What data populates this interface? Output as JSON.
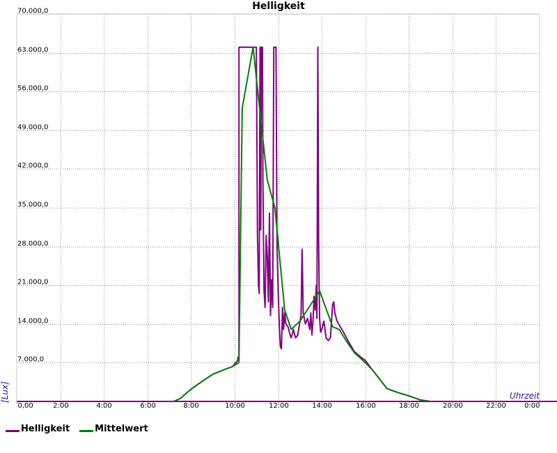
{
  "chart_data": {
    "type": "line",
    "title": "Helligkeit",
    "xlabel": "Uhrzeit",
    "ylabel": "[Lux]",
    "xlim": [
      0,
      24
    ],
    "ylim": [
      0,
      70000
    ],
    "x_ticks": [
      0,
      2,
      4,
      6,
      8,
      10,
      12,
      14,
      16,
      18,
      20,
      22,
      24
    ],
    "x_tick_labels": [
      "0,00",
      "2:00",
      "4:00",
      "6:00",
      "8:00",
      "10:00",
      "12:00",
      "14:00",
      "16:00",
      "18:00",
      "20:00",
      "22:00",
      "0:00"
    ],
    "y_ticks": [
      7000,
      14000,
      21000,
      28000,
      35000,
      42000,
      49000,
      56000,
      63000,
      70000
    ],
    "y_tick_labels": [
      "7.000,0",
      "14.000,0",
      "21.000,0",
      "28.000,0",
      "35.000,0",
      "42.000,0",
      "49.000,0",
      "56.000,0",
      "63.000,0",
      "70.000,0"
    ],
    "grid": true,
    "legend_position": "bottom-left",
    "series": [
      {
        "name": "Helligkeit",
        "color": "#800080",
        "points": [
          [
            0,
            0
          ],
          [
            7.2,
            0
          ],
          [
            7.5,
            500
          ],
          [
            8.0,
            2200
          ],
          [
            8.5,
            3600
          ],
          [
            9.0,
            4900
          ],
          [
            9.5,
            5700
          ],
          [
            9.9,
            6300
          ],
          [
            10.15,
            7400
          ],
          [
            10.15,
            7900
          ],
          [
            10.2,
            8200
          ],
          [
            10.2,
            64000
          ],
          [
            10.3,
            64000
          ],
          [
            10.6,
            64000
          ],
          [
            10.9,
            64000
          ],
          [
            11.0,
            64000
          ],
          [
            11.05,
            30000
          ],
          [
            11.1,
            21000
          ],
          [
            11.13,
            19500
          ],
          [
            11.17,
            64000
          ],
          [
            11.2,
            31000
          ],
          [
            11.23,
            64000
          ],
          [
            11.28,
            64000
          ],
          [
            11.3,
            40000
          ],
          [
            11.35,
            20000
          ],
          [
            11.4,
            17000
          ],
          [
            11.45,
            30000
          ],
          [
            11.5,
            26000
          ],
          [
            11.55,
            18000
          ],
          [
            11.6,
            34000
          ],
          [
            11.65,
            15500
          ],
          [
            11.7,
            22000
          ],
          [
            11.75,
            17000
          ],
          [
            11.8,
            64000
          ],
          [
            11.9,
            64000
          ],
          [
            11.95,
            28000
          ],
          [
            12.0,
            20000
          ],
          [
            12.05,
            14000
          ],
          [
            12.1,
            10000
          ],
          [
            12.15,
            9500
          ],
          [
            12.2,
            17000
          ],
          [
            12.25,
            13000
          ],
          [
            12.3,
            16000
          ],
          [
            12.35,
            14000
          ],
          [
            12.45,
            13500
          ],
          [
            12.55,
            12000
          ],
          [
            12.6,
            11500
          ],
          [
            12.7,
            13000
          ],
          [
            12.8,
            11500
          ],
          [
            12.9,
            12000
          ],
          [
            13.0,
            14500
          ],
          [
            13.05,
            15500
          ],
          [
            13.1,
            27500
          ],
          [
            13.15,
            16000
          ],
          [
            13.25,
            14000
          ],
          [
            13.35,
            15000
          ],
          [
            13.45,
            13000
          ],
          [
            13.5,
            16000
          ],
          [
            13.55,
            12000
          ],
          [
            13.6,
            14500
          ],
          [
            13.65,
            19000
          ],
          [
            13.7,
            16500
          ],
          [
            13.75,
            21000
          ],
          [
            13.78,
            15000
          ],
          [
            13.82,
            64000
          ],
          [
            13.86,
            28000
          ],
          [
            13.9,
            15000
          ],
          [
            13.95,
            12500
          ],
          [
            14.0,
            13000
          ],
          [
            14.1,
            14500
          ],
          [
            14.15,
            13000
          ],
          [
            14.2,
            11500
          ],
          [
            14.3,
            11000
          ],
          [
            14.4,
            11500
          ],
          [
            14.5,
            17500
          ],
          [
            14.55,
            18000
          ],
          [
            14.6,
            16000
          ],
          [
            14.7,
            14500
          ],
          [
            14.85,
            13500
          ],
          [
            15.0,
            12500
          ],
          [
            15.2,
            11000
          ],
          [
            15.5,
            9000
          ],
          [
            15.8,
            8000
          ],
          [
            16.0,
            7400
          ],
          [
            16.3,
            5800
          ],
          [
            16.7,
            3800
          ],
          [
            17.0,
            2300
          ],
          [
            17.5,
            1600
          ],
          [
            18.0,
            1000
          ],
          [
            18.5,
            300
          ],
          [
            18.8,
            50
          ],
          [
            19.0,
            0
          ],
          [
            24.0,
            0
          ]
        ]
      },
      {
        "name": "Mittelwert",
        "color": "#008000",
        "points": [
          [
            0,
            0
          ],
          [
            7.2,
            0
          ],
          [
            7.5,
            500
          ],
          [
            8.0,
            2200
          ],
          [
            8.5,
            3600
          ],
          [
            9.0,
            4900
          ],
          [
            9.5,
            5700
          ],
          [
            9.9,
            6300
          ],
          [
            10.2,
            7000
          ],
          [
            10.35,
            53000
          ],
          [
            10.85,
            64000
          ],
          [
            11.5,
            40000
          ],
          [
            11.85,
            35000
          ],
          [
            12.3,
            16500
          ],
          [
            12.6,
            13000
          ],
          [
            13.0,
            14500
          ],
          [
            13.5,
            17500
          ],
          [
            13.9,
            20000
          ],
          [
            14.5,
            13500
          ],
          [
            14.8,
            13000
          ],
          [
            15.2,
            10500
          ],
          [
            15.5,
            8800
          ],
          [
            16.0,
            7000
          ],
          [
            16.3,
            5800
          ],
          [
            16.7,
            3800
          ],
          [
            17.0,
            2300
          ],
          [
            17.5,
            1600
          ],
          [
            18.0,
            1000
          ],
          [
            18.5,
            300
          ],
          [
            19.0,
            0
          ],
          [
            24.0,
            0
          ]
        ]
      }
    ]
  }
}
